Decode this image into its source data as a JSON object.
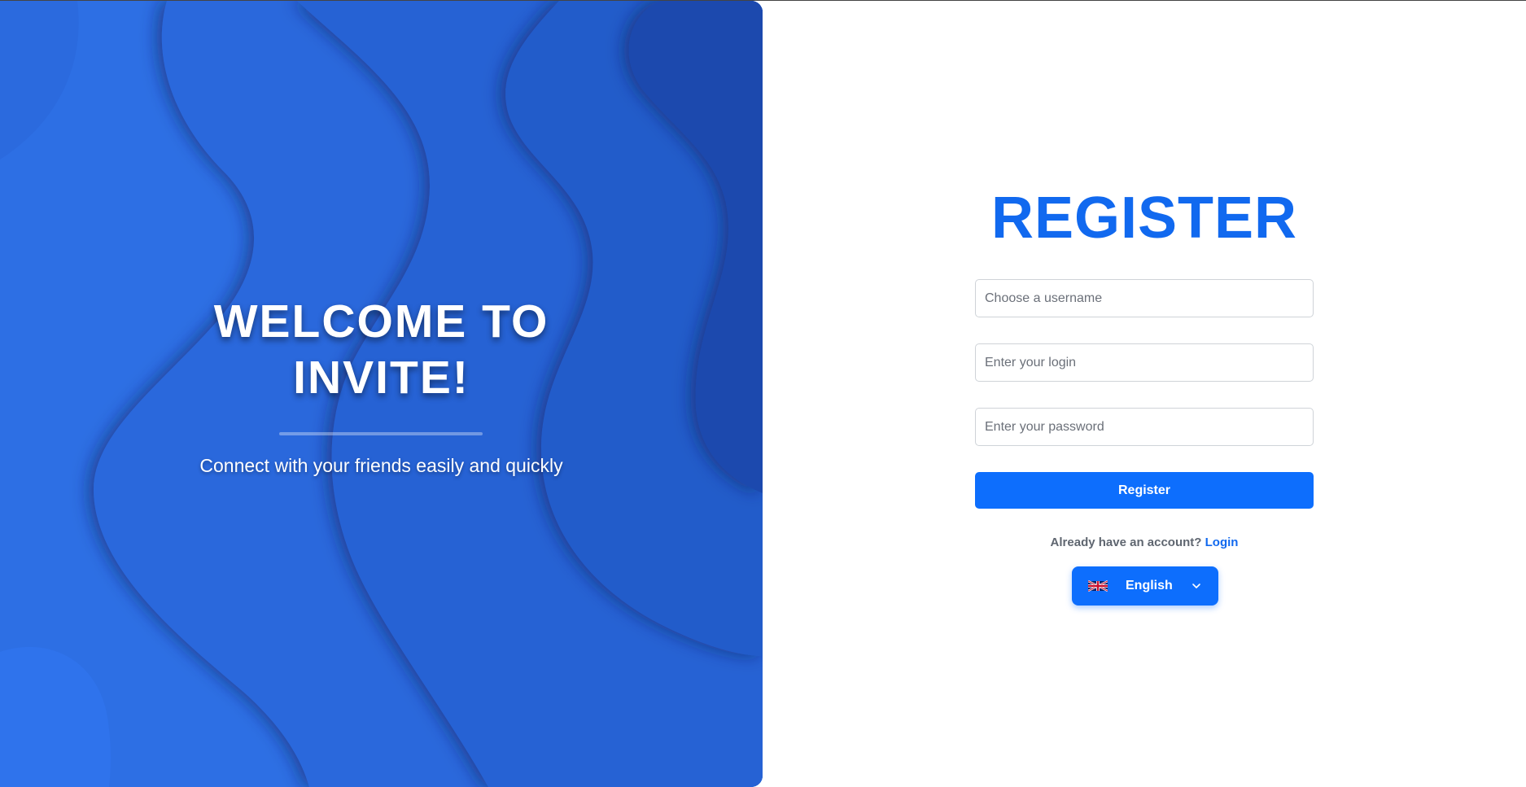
{
  "hero": {
    "title_line1": "WELCOME TO",
    "title_line2": "INVITE!",
    "subtitle": "Connect with your friends easily and quickly"
  },
  "form": {
    "title": "REGISTER",
    "username_placeholder": "Choose a username",
    "login_placeholder": "Enter your login",
    "password_placeholder": "Enter your password",
    "submit_label": "Register",
    "account_prompt": "Already have an account?",
    "login_link": "Login"
  },
  "language": {
    "selected": "English",
    "flag_icon": "uk-flag-icon",
    "chevron_icon": "chevron-down-icon"
  },
  "colors": {
    "accent": "#0d6efd",
    "title": "#1169ef",
    "hero_background": "#2160cc"
  }
}
